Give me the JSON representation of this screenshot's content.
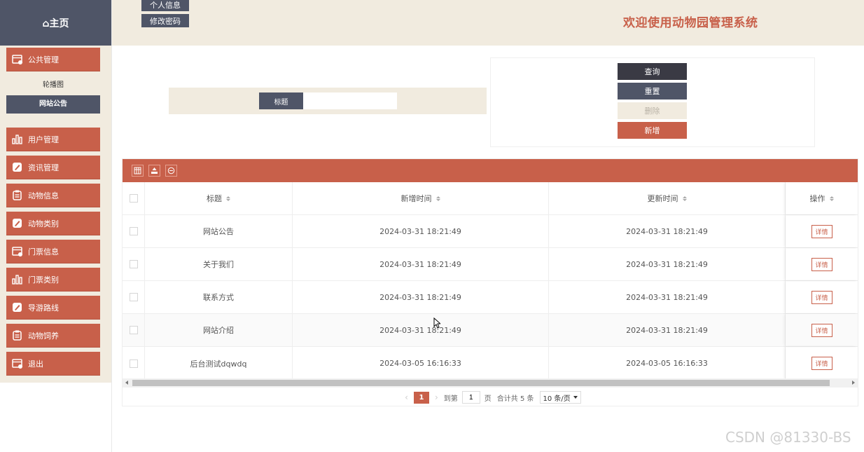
{
  "sidebar": {
    "home_label": "⌂主页",
    "items": [
      {
        "label": "公共管理",
        "icon": "calendar-icon"
      },
      {
        "label": "用户管理",
        "icon": "bar-chart-icon"
      },
      {
        "label": "资讯管理",
        "icon": "edit-icon"
      },
      {
        "label": "动物信息",
        "icon": "clipboard-icon"
      },
      {
        "label": "动物类别",
        "icon": "edit-icon"
      },
      {
        "label": "门票信息",
        "icon": "calendar-icon"
      },
      {
        "label": "门票类别",
        "icon": "bar-chart-icon"
      },
      {
        "label": "导游路线",
        "icon": "edit-icon"
      },
      {
        "label": "动物饲养",
        "icon": "clipboard-icon"
      },
      {
        "label": "退出",
        "icon": "calendar-icon"
      }
    ],
    "submenu": {
      "carousel": "轮播图",
      "announcement": "网站公告"
    }
  },
  "header": {
    "profile_label": "个人信息",
    "password_label": "修改密码",
    "title": "欢迎使用动物园管理系统"
  },
  "search": {
    "label": "标题",
    "value": ""
  },
  "actions": {
    "query": "查询",
    "reset": "重置",
    "delete": "删除",
    "add": "新增"
  },
  "table": {
    "columns": {
      "title": "标题",
      "created": "新增时间",
      "updated": "更新时间",
      "op": "操作"
    },
    "rows": [
      {
        "title": "网站公告",
        "created": "2024-03-31 18:21:49",
        "updated": "2024-03-31 18:21:49",
        "op": "详情"
      },
      {
        "title": "关于我们",
        "created": "2024-03-31 18:21:49",
        "updated": "2024-03-31 18:21:49",
        "op": "详情"
      },
      {
        "title": "联系方式",
        "created": "2024-03-31 18:21:49",
        "updated": "2024-03-31 18:21:49",
        "op": "详情"
      },
      {
        "title": "网站介绍",
        "created": "2024-03-31 18:21:49",
        "updated": "2024-03-31 18:21:49",
        "op": "详情"
      },
      {
        "title": "后台测试dqwdq",
        "created": "2024-03-05 16:16:33",
        "updated": "2024-03-05 16:16:33",
        "op": "详情"
      }
    ]
  },
  "pagination": {
    "current_page": "1",
    "goto_label": "到第",
    "goto_value": "1",
    "page_unit": "页",
    "total_text": "合计共 5 条",
    "page_size": "10 条/页"
  },
  "watermark": "CSDN @81330-BS",
  "colors": {
    "accent": "#c8604a",
    "dark": "#4f5567",
    "cream": "#f1ebdf"
  }
}
